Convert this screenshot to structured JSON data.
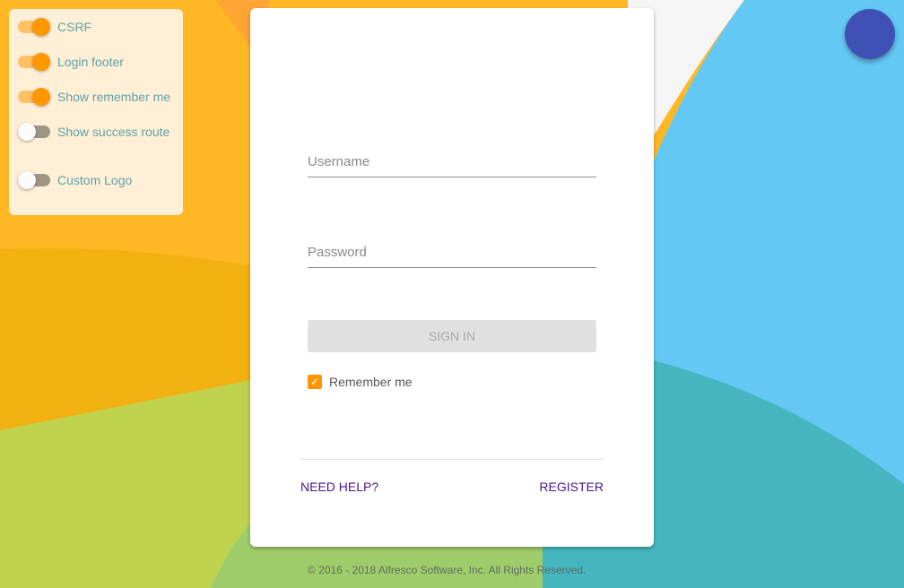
{
  "colors": {
    "accent": "#FF9800",
    "primary": "#3F51B5",
    "link": "#4A148C"
  },
  "settings": [
    {
      "label": "CSRF",
      "on": true
    },
    {
      "label": "Login footer",
      "on": true
    },
    {
      "label": "Show remember me",
      "on": true
    },
    {
      "label": "Show success route",
      "on": false
    },
    {
      "label": "Custom Logo",
      "on": false
    }
  ],
  "login": {
    "username_placeholder": "Username",
    "password_placeholder": "Password",
    "sign_in": "SIGN IN",
    "remember_me": "Remember me",
    "remember_checked": true,
    "need_help": "NEED HELP?",
    "register": "REGISTER"
  },
  "footer": "© 2016 - 2018 Alfresco Software, Inc. All Rights Reserved."
}
